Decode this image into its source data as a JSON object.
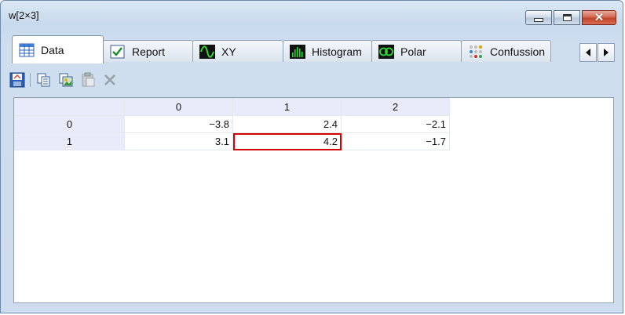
{
  "window": {
    "title": "w[2×3]"
  },
  "tabs": [
    {
      "label": "Data",
      "icon": "table-icon",
      "active": true
    },
    {
      "label": "Report",
      "icon": "check-icon"
    },
    {
      "label": "XY",
      "icon": "sine-wave-icon"
    },
    {
      "label": "Histogram",
      "icon": "histogram-icon"
    },
    {
      "label": "Polar",
      "icon": "polar-icon"
    },
    {
      "label": "Confussion",
      "icon": "dots-grid-icon"
    }
  ],
  "toolbar": [
    "save-icon",
    "copy-icon",
    "copy-image-icon",
    "paste-icon",
    "delete-icon"
  ],
  "grid": {
    "columns": [
      "0",
      "1",
      "2"
    ],
    "rows": [
      {
        "header": "0",
        "cells": [
          "−3.8",
          "2.4",
          "−2.1"
        ]
      },
      {
        "header": "1",
        "cells": [
          "3.1",
          "4.2",
          "−1.7"
        ]
      }
    ],
    "selected": {
      "row": 1,
      "col": 1
    },
    "selection_color": "#d40000"
  }
}
